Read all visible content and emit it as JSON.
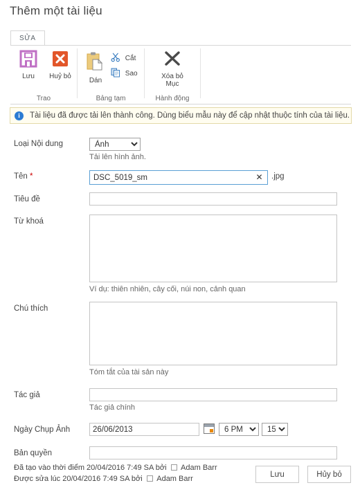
{
  "page": {
    "title": "Thêm một tài liệu"
  },
  "ribbon": {
    "tabs": [
      {
        "label": "SỬA",
        "active": true
      }
    ],
    "groups": [
      {
        "name": "Trao",
        "label": "Trao"
      },
      {
        "name": "Bảng tạm",
        "label": "Bảng tạm"
      },
      {
        "name": "Hành động",
        "label": "Hành động"
      }
    ],
    "buttons": {
      "save": {
        "label": "Lưu",
        "icon": "floppy-disk-icon",
        "color": "#bf6fc4"
      },
      "cancel": {
        "label": "Huỷ bỏ",
        "icon": "cancel-x-icon",
        "color": "#e2562a"
      },
      "paste": {
        "label": "Dán",
        "icon": "clipboard-icon",
        "color": "#e8bf62"
      },
      "cut": {
        "label": "Cắt",
        "icon": "scissors-icon",
        "color": "#3d7fc1"
      },
      "copy": {
        "label": "Sao",
        "icon": "copy-icon",
        "color": "#3d7fc1"
      },
      "delete_item": {
        "label_line1": "Xóa bỏ",
        "label_line2": "Mục",
        "icon": "delete-x-icon",
        "color": "#4a4a4a"
      }
    }
  },
  "notification": {
    "icon": "info-icon",
    "glyph": "i",
    "message": "Tài liệu đã được tải lên thành công. Dùng biểu mẫu này để cập nhật thuộc tính của tài liệu.",
    "background": "#fffdf0",
    "border": "#e3d9a8",
    "icon_color": "#2b7cd3"
  },
  "form": {
    "content_type": {
      "label": "Loại Nội dung",
      "value": "Ảnh",
      "options": [
        "Ảnh"
      ],
      "hint": "Tải lên hình ảnh."
    },
    "name": {
      "label": "Tên",
      "required_marker": "*",
      "value": "DSC_5019_sm",
      "extension": ".jpg",
      "clear_glyph": "✕",
      "focused": true
    },
    "title_field": {
      "label": "Tiêu đề",
      "value": ""
    },
    "keywords": {
      "label": "Từ khoá",
      "value": "",
      "hint": "Ví dụ: thiên nhiên, cây cối, núi non, cảnh quan"
    },
    "comments": {
      "label": "Chú thích",
      "value": "",
      "hint": "Tóm tắt của tài sản này"
    },
    "author": {
      "label": "Tác giả",
      "value": "",
      "hint": "Tác giả chính"
    },
    "date_picture_taken": {
      "label": "Ngày Chụp Ảnh",
      "date_value": "26/06/2013",
      "calendar_icon": "calendar-icon",
      "hour_value": "6 PM",
      "hour_options": [
        "6 PM"
      ],
      "minute_value": "15",
      "minute_options": [
        "15"
      ]
    },
    "copyright": {
      "label": "Bản quyền",
      "value": ""
    }
  },
  "footer": {
    "created_text": "Đã tạo vào thời điểm 20/04/2016 7:49 SA  bởi",
    "created_user": "Adam Barr",
    "modified_text": "Được sửa lúc 20/04/2016 7:49 SA  bởi",
    "modified_user": "Adam Barr",
    "save_label": "Lưu",
    "cancel_label": "Hủy bỏ"
  }
}
